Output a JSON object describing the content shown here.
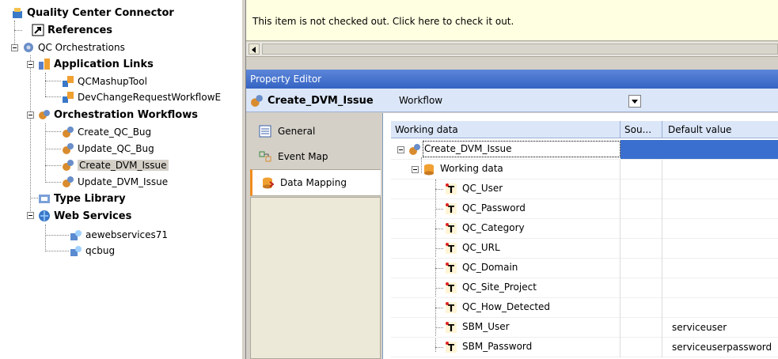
{
  "tree": {
    "items": [
      {
        "label": "Quality Center Connector",
        "bold": true,
        "icon": "project-icon"
      },
      {
        "label": "References",
        "bold": true,
        "icon": "shortcut-icon"
      },
      {
        "label": "QC Orchestrations",
        "bold": false,
        "icon": "orchestration-icon"
      },
      {
        "label": "Application Links",
        "bold": true,
        "icon": "application-links-icon"
      },
      {
        "label": "QCMashupTool",
        "bold": false,
        "icon": "application-icon"
      },
      {
        "label": "DevChangeRequestWorkflowE",
        "bold": false,
        "icon": "application-icon"
      },
      {
        "label": "Orchestration Workflows",
        "bold": true,
        "icon": "workflows-folder-icon"
      },
      {
        "label": "Create_QC_Bug",
        "bold": false,
        "icon": "workflow-icon"
      },
      {
        "label": "Update_QC_Bug",
        "bold": false,
        "icon": "workflow-icon"
      },
      {
        "label": "Create_DVM_Issue",
        "bold": false,
        "icon": "workflow-icon",
        "selected": true
      },
      {
        "label": "Update_DVM_Issue",
        "bold": false,
        "icon": "workflow-icon"
      },
      {
        "label": "Type Library",
        "bold": true,
        "icon": "type-library-icon"
      },
      {
        "label": "Web Services",
        "bold": true,
        "icon": "web-services-icon"
      },
      {
        "label": "aewebservices71",
        "bold": false,
        "icon": "web-service-icon"
      },
      {
        "label": "qcbug",
        "bold": false,
        "icon": "web-service-icon"
      }
    ]
  },
  "notice": {
    "text": "This item is not checked out.  Click here to check it out."
  },
  "property_editor": {
    "title": "Property Editor",
    "object_name": "Create_DVM_Issue",
    "object_type": "Workflow",
    "tabs": [
      {
        "label": "General",
        "icon": "general-icon",
        "active": false
      },
      {
        "label": "Event Map",
        "icon": "event-map-icon",
        "active": false
      },
      {
        "label": "Data Mapping",
        "icon": "data-mapping-icon",
        "active": true
      }
    ]
  },
  "grid": {
    "headers": [
      "Working data",
      "Sou...",
      "Default value"
    ],
    "rows": [
      {
        "name": "Create_DVM_Issue",
        "default": "",
        "icon": "workflow-icon",
        "level": 0
      },
      {
        "name": "Working data",
        "default": "",
        "icon": "database-icon",
        "level": 1
      },
      {
        "name": "QC_User",
        "default": "",
        "icon": "text-field-icon",
        "level": 2
      },
      {
        "name": "QC_Password",
        "default": "",
        "icon": "text-field-icon",
        "level": 2
      },
      {
        "name": "QC_Category",
        "default": "",
        "icon": "text-field-icon",
        "level": 2
      },
      {
        "name": "QC_URL",
        "default": "",
        "icon": "text-field-icon",
        "level": 2
      },
      {
        "name": "QC_Domain",
        "default": "",
        "icon": "text-field-icon",
        "level": 2
      },
      {
        "name": "QC_Site_Project",
        "default": "",
        "icon": "text-field-icon",
        "level": 2
      },
      {
        "name": "QC_How_Detected",
        "default": "",
        "icon": "text-field-icon",
        "level": 2
      },
      {
        "name": "SBM_User",
        "default": "serviceuser",
        "icon": "text-field-icon",
        "level": 2
      },
      {
        "name": "SBM_Password",
        "default": "serviceuserpassword",
        "icon": "text-field-icon",
        "level": 2
      }
    ]
  },
  "colors": {
    "accent": "#3a6fcf",
    "notice_bg": "#ffffe1",
    "title_bar": "#3563c3",
    "active_tab_marker": "#f08c1e"
  }
}
